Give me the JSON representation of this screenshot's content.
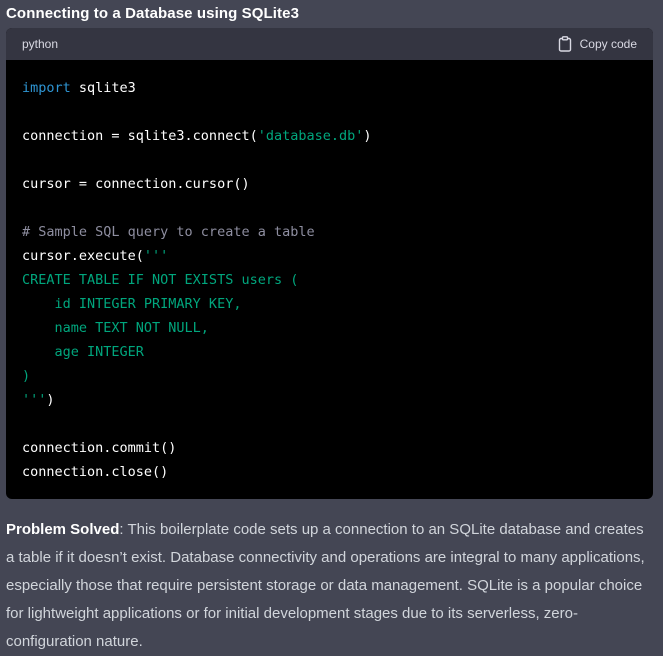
{
  "heading": "Connecting to a Database using SQLite3",
  "code_block": {
    "language": "python",
    "copy_label": "Copy code",
    "copy_icon": "clipboard-icon",
    "lines": [
      [
        {
          "t": "import",
          "c": "kw"
        },
        {
          "t": " sqlite3",
          "c": ""
        }
      ],
      [],
      [
        {
          "t": "connection = sqlite3.connect(",
          "c": ""
        },
        {
          "t": "'database.db'",
          "c": "str"
        },
        {
          "t": ")",
          "c": ""
        }
      ],
      [],
      [
        {
          "t": "cursor = connection.cursor()",
          "c": ""
        }
      ],
      [],
      [
        {
          "t": "# Sample SQL query to create a table",
          "c": "cm"
        }
      ],
      [
        {
          "t": "cursor.execute(",
          "c": ""
        },
        {
          "t": "'''",
          "c": "str"
        }
      ],
      [
        {
          "t": "CREATE TABLE IF NOT EXISTS users (",
          "c": "str"
        }
      ],
      [
        {
          "t": "    id INTEGER PRIMARY KEY,",
          "c": "str"
        }
      ],
      [
        {
          "t": "    name TEXT NOT NULL,",
          "c": "str"
        }
      ],
      [
        {
          "t": "    age INTEGER",
          "c": "str"
        }
      ],
      [
        {
          "t": ")",
          "c": "str"
        }
      ],
      [
        {
          "t": "'''",
          "c": "str"
        },
        {
          "t": ")",
          "c": ""
        }
      ],
      [],
      [
        {
          "t": "connection.commit()",
          "c": ""
        }
      ],
      [
        {
          "t": "connection.close()",
          "c": ""
        }
      ]
    ]
  },
  "description": {
    "bold": "Problem Solved",
    "text": ": This boilerplate code sets up a connection to an SQLite database and creates a table if it doesn’t exist. Database connectivity and operations are integral to many applications, especially those that require persistent storage or data management. SQLite is a popular choice for lightweight applications or for initial development stages due to its serverless, zero-configuration nature."
  },
  "colors": {
    "background": "#444654",
    "code_background": "#000000",
    "code_header": "#343541",
    "keyword": "#2e95d3",
    "string": "#00a67d",
    "comment": "#8e8ea0"
  }
}
